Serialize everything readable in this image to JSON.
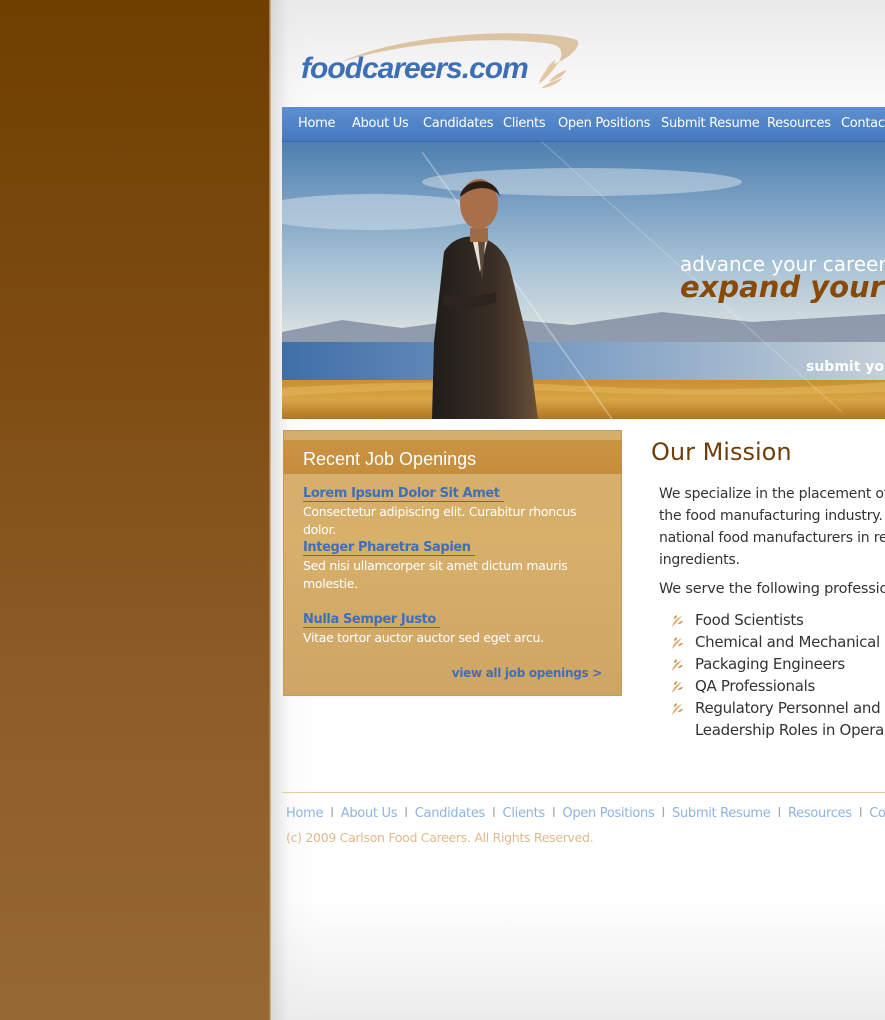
{
  "logo": {
    "text": "foodcareers.com"
  },
  "nav": {
    "items": [
      "Home",
      "About Us",
      "Candidates",
      "Clients",
      "Open Positions",
      "Submit Resume",
      "Resources",
      "Contact"
    ]
  },
  "hero": {
    "line1": "advance your career.",
    "line2": "expand your h",
    "submit": "submit your"
  },
  "jobs": {
    "title": "Recent Job Openings",
    "items": [
      {
        "title": "Lorem Ipsum Dolor Sit Amet",
        "desc": "Consectetur adipiscing elit. Curabitur rhoncus dolor."
      },
      {
        "title": "Integer Pharetra Sapien",
        "desc": "Sed nisi ullamcorper sit amet dictum mauris molestie."
      },
      {
        "title": "Nulla Semper Justo",
        "desc": "Vitae tortor auctor auctor sed eget arcu."
      }
    ],
    "view_all": "view all job openings >"
  },
  "mission": {
    "title": "Our Mission",
    "lines": [
      "We specialize in the placement of",
      "the food manufacturing industry.",
      "national food manufacturers in ret",
      "ingredients."
    ],
    "serve": "We serve the following professio",
    "professions": [
      "Food Scientists",
      "Chemical and Mechanical E",
      "Packaging Engineers",
      "QA Professionals",
      "Regulatory Personnel and"
    ],
    "profession_cont": "Leadership Roles in Opera"
  },
  "footer": {
    "links": [
      "Home",
      "About Us",
      "Candidates",
      "Clients",
      "Open Positions",
      "Submit Resume",
      "Resources",
      "Contact"
    ],
    "copyright": "(c) 2009 Carlson Food Careers. All Rights Reserved."
  },
  "colors": {
    "brand_blue": "#3d6fb6",
    "brand_brown": "#6e3f0a",
    "sidebar_brown": "#7e4c12",
    "job_box_tan": "#d7b06a"
  }
}
